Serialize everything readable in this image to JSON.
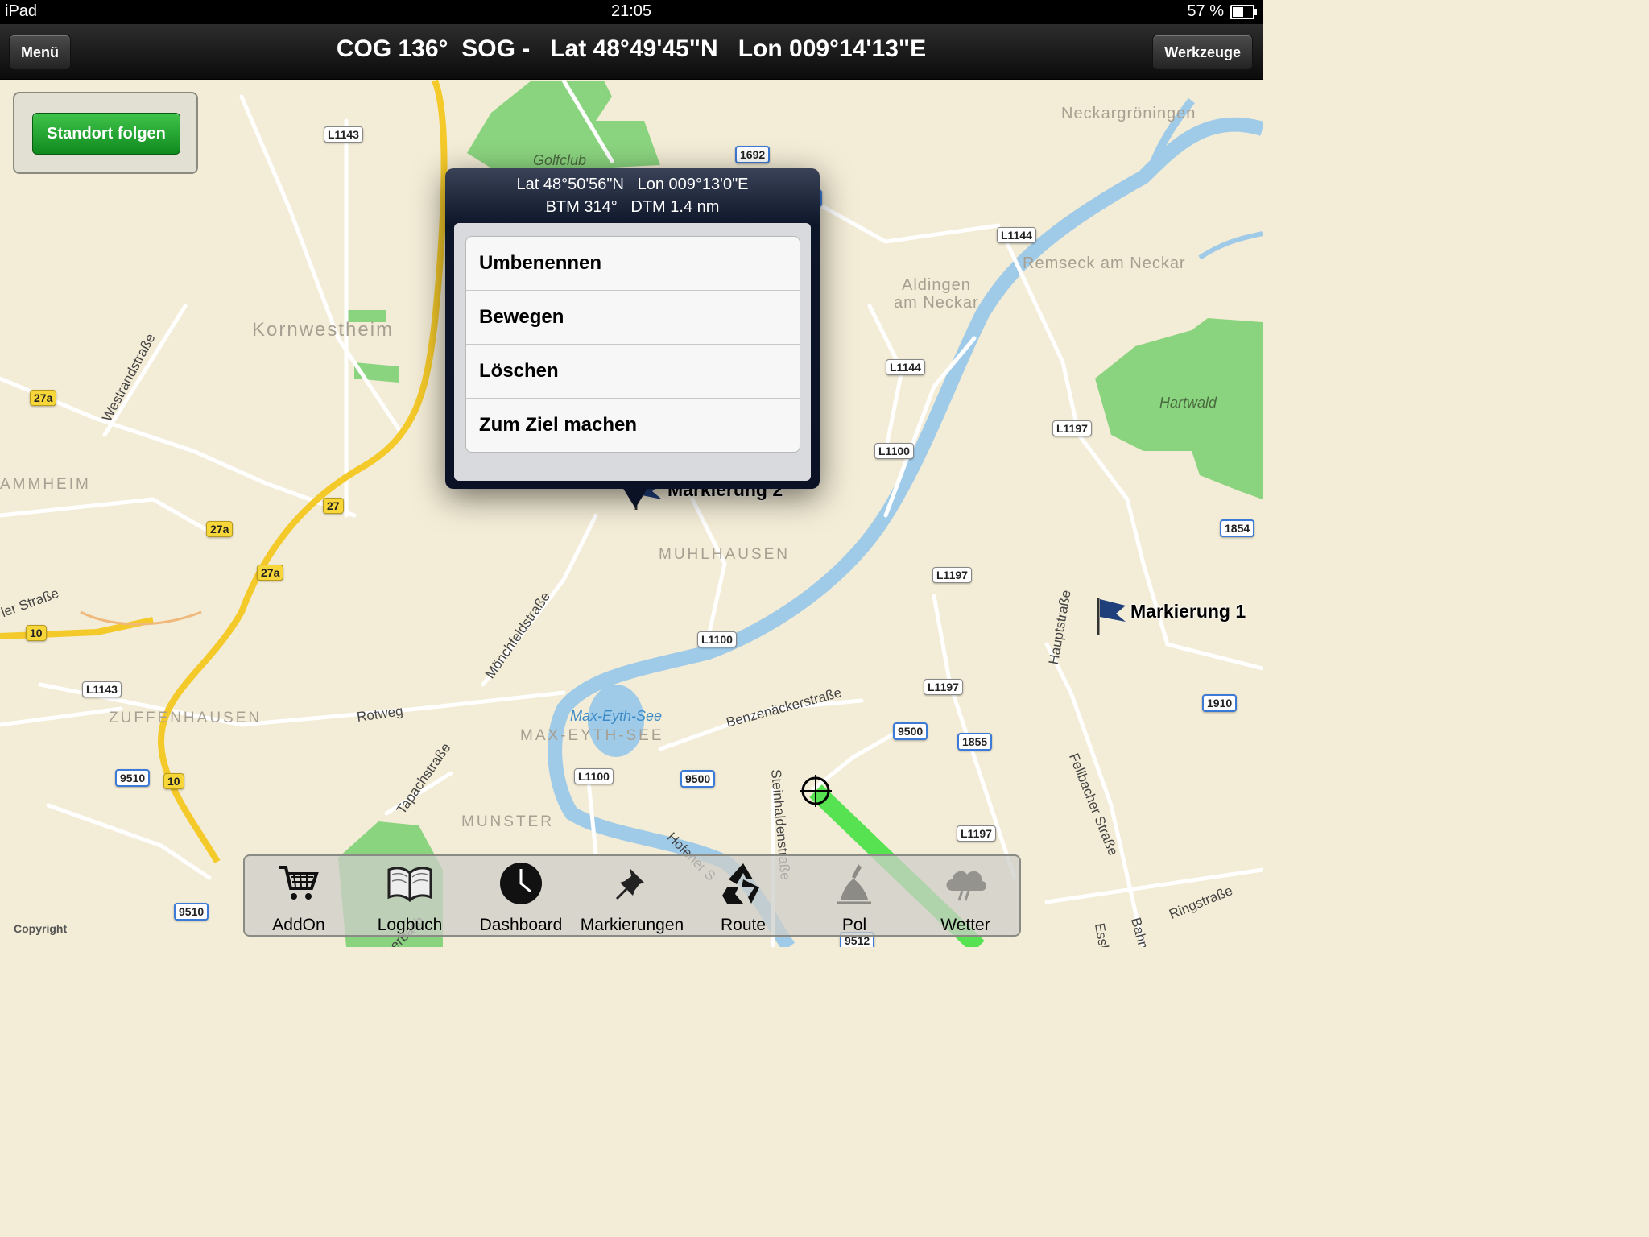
{
  "status_bar": {
    "device": "iPad",
    "time": "21:05",
    "battery": "57 %",
    "battery_level": 0.57
  },
  "nav": {
    "menu_label": "Menü",
    "tools_label": "Werkzeuge",
    "info": "COG 136°  SOG -   Lat 48°49'45\"N   Lon 009°14'13\"E"
  },
  "follow_label": "Standort folgen",
  "popover": {
    "line1": "Lat 48°50'56\"N   Lon 009°13'0\"E",
    "line2": "BTM 314°   DTM 1.4 nm",
    "items": [
      "Umbenennen",
      "Bewegen",
      "Löschen",
      "Zum Ziel machen"
    ]
  },
  "markers": {
    "m1": "Markierung 1",
    "m2": "Markierung 2"
  },
  "map": {
    "places": [
      "Kornwestheim",
      "AMMHEIM",
      "ZUFFENHAUSEN",
      "MUHLHAUSEN",
      "MAX-EYTH-SEE",
      "MUNSTER",
      "Neckargröningen",
      "Remseck am Neckar",
      "Aldingen",
      "am Neckar",
      "Hartwald",
      "Golfclub",
      "Max-Eyth-See"
    ],
    "streets": [
      "Westrandstraße",
      "Mönchfeldstraße",
      "Rotweg",
      "Tapachstraße",
      "Benzenäckerstraße",
      "Steinhaldenstraße",
      "Hofener S",
      "Hauptstraße",
      "Fellbacher Straße",
      "Ringstraße",
      "ler Straße",
      "Bahn",
      "Essli",
      "erbach"
    ],
    "shields": [
      "L1143",
      "1692",
      "L1144",
      "L1144",
      "L1197",
      "L1100",
      "1854",
      "L1197",
      "L1100",
      "L1197",
      "1910",
      "9500",
      "1855",
      "9500",
      "L1100",
      "L1197",
      "27a",
      "27",
      "27a",
      "27a",
      "10",
      "L1143",
      "9510",
      "10",
      "9510",
      "9512",
      "1692"
    ]
  },
  "toolbar": {
    "items": [
      {
        "label": "AddOn",
        "icon": "cart-icon"
      },
      {
        "label": "Logbuch",
        "icon": "book-icon"
      },
      {
        "label": "Dashboard",
        "icon": "clock-icon"
      },
      {
        "label": "Markierungen",
        "icon": "pushpin-icon"
      },
      {
        "label": "Route",
        "icon": "recycle-icon"
      },
      {
        "label": "Pol",
        "icon": "polar-icon"
      },
      {
        "label": "Wetter",
        "icon": "cloud-icon"
      }
    ]
  },
  "copyright": "Copyright",
  "colors": {
    "follow_button": "#1ea82d",
    "track": "#39e13a",
    "water": "#a9d2ee",
    "park": "#7fd27a",
    "highway": "#f4c92a"
  }
}
